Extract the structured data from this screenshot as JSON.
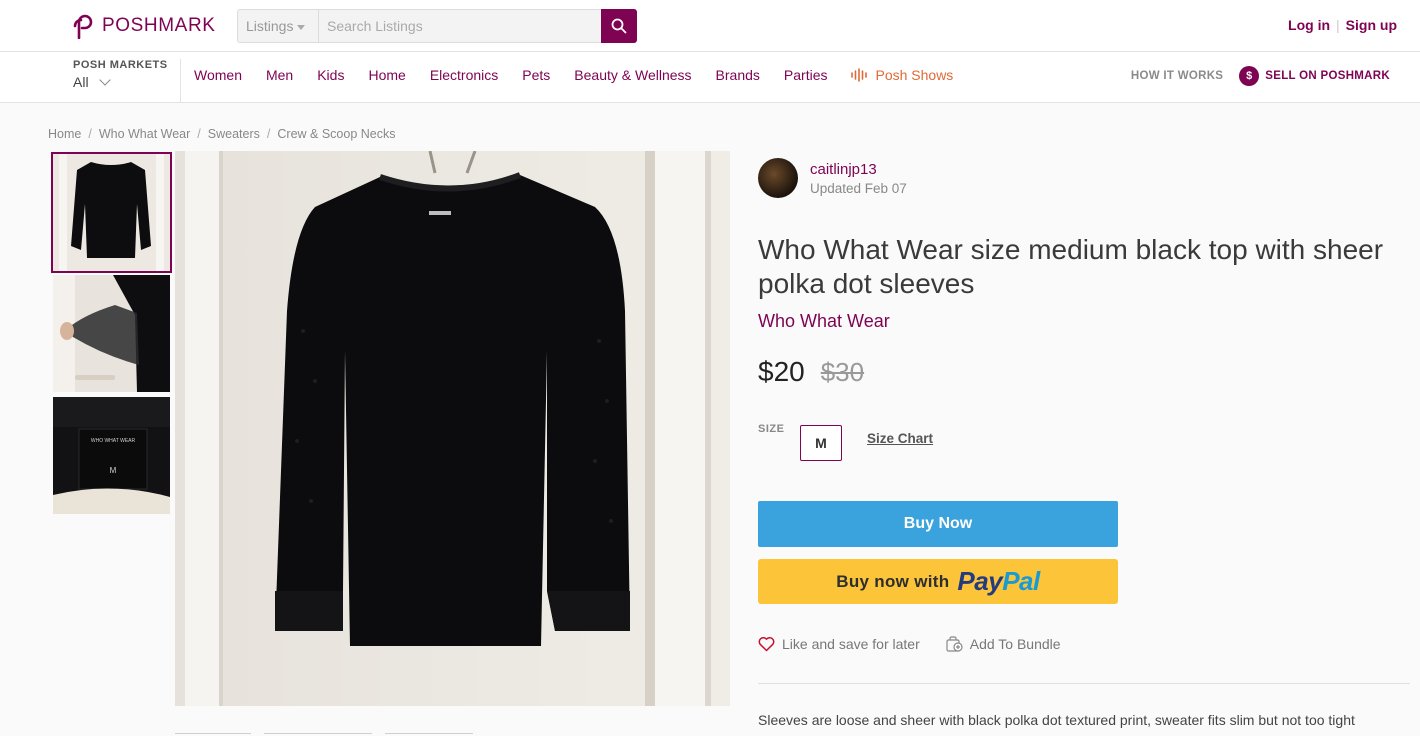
{
  "header": {
    "logo_text": "POSHMARK",
    "search_scope": "Listings",
    "search_placeholder": "Search Listings",
    "login": "Log in",
    "separator": "|",
    "signup": "Sign up",
    "brand_color": "#7f0353"
  },
  "nav": {
    "markets_label": "POSH MARKETS",
    "markets_value": "All",
    "items": [
      "Women",
      "Men",
      "Kids",
      "Home",
      "Electronics",
      "Pets",
      "Beauty & Wellness",
      "Brands",
      "Parties"
    ],
    "posh_shows": "Posh Shows",
    "how_it_works": "HOW IT WORKS",
    "sell": "SELL ON POSHMARK",
    "sell_icon_glyph": "$"
  },
  "breadcrumb": [
    "Home",
    "Who What Wear",
    "Sweaters",
    "Crew & Scoop Necks"
  ],
  "gallery": {
    "thumb_label_text": "WHO WHAT WEAR",
    "thumb_size_text": "M"
  },
  "listing": {
    "seller_name": "caitlinjp13",
    "updated": "Updated Feb 07",
    "title": "Who What Wear size medium black top with sheer polka dot sleeves",
    "brand": "Who What Wear",
    "price": "$20",
    "original_price": "$30",
    "size_label": "SIZE",
    "size": "M",
    "size_chart": "Size Chart",
    "buy_now": "Buy Now",
    "paypal_prefix": "Buy now with",
    "paypal_pay": "Pay",
    "paypal_pal": "Pal",
    "like": "Like and save for later",
    "bundle": "Add To Bundle",
    "description": "Sleeves are loose and sheer with black polka dot textured print, sweater fits slim but not too tight"
  }
}
